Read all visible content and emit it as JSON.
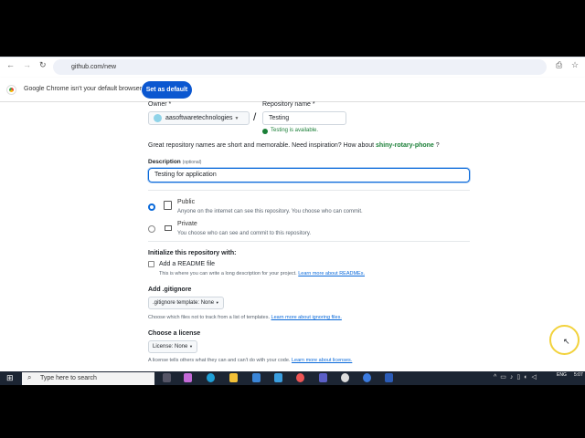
{
  "browser": {
    "url": "github.com/new",
    "infobar_text": "Google Chrome isn't your default browser",
    "set_default_label": "Set as default"
  },
  "form": {
    "owner_label": "Owner *",
    "owner_value": "aasoftwaretechnologies",
    "slash": "/",
    "repo_label": "Repository name *",
    "repo_value": "Testing",
    "availability": "Testing is available.",
    "suggestion_text": "Great repository names are short and memorable. Need inspiration? How about",
    "suggestion_name": "shiny-rotary-phone",
    "suggestion_end": "?",
    "description_label": "Description",
    "description_optional": "(optional)",
    "description_value": "Testing for application",
    "visibility": [
      {
        "label": "Public",
        "desc": "Anyone on the internet can see this repository. You choose who can commit.",
        "selected": true
      },
      {
        "label": "Private",
        "desc": "You choose who can see and commit to this repository.",
        "selected": false
      }
    ],
    "init_heading": "Initialize this repository with:",
    "readme_label": "Add a README file",
    "readme_checked": false,
    "readme_desc": "This is where you can write a long description for your project.",
    "readme_link": "Learn more about READMEs.",
    "gitignore_heading": "Add .gitignore",
    "gitignore_select": ".gitignore template: None",
    "gitignore_desc": "Choose which files not to track from a list of templates.",
    "gitignore_link": "Learn more about ignoring files.",
    "license_heading": "Choose a license",
    "license_select": "License: None",
    "license_desc": "A license tells others what they can and can't do with your code.",
    "license_link": "Learn more about licenses."
  },
  "taskbar": {
    "search_placeholder": "Type here to search",
    "lang": "ENG",
    "time": "5:07"
  }
}
